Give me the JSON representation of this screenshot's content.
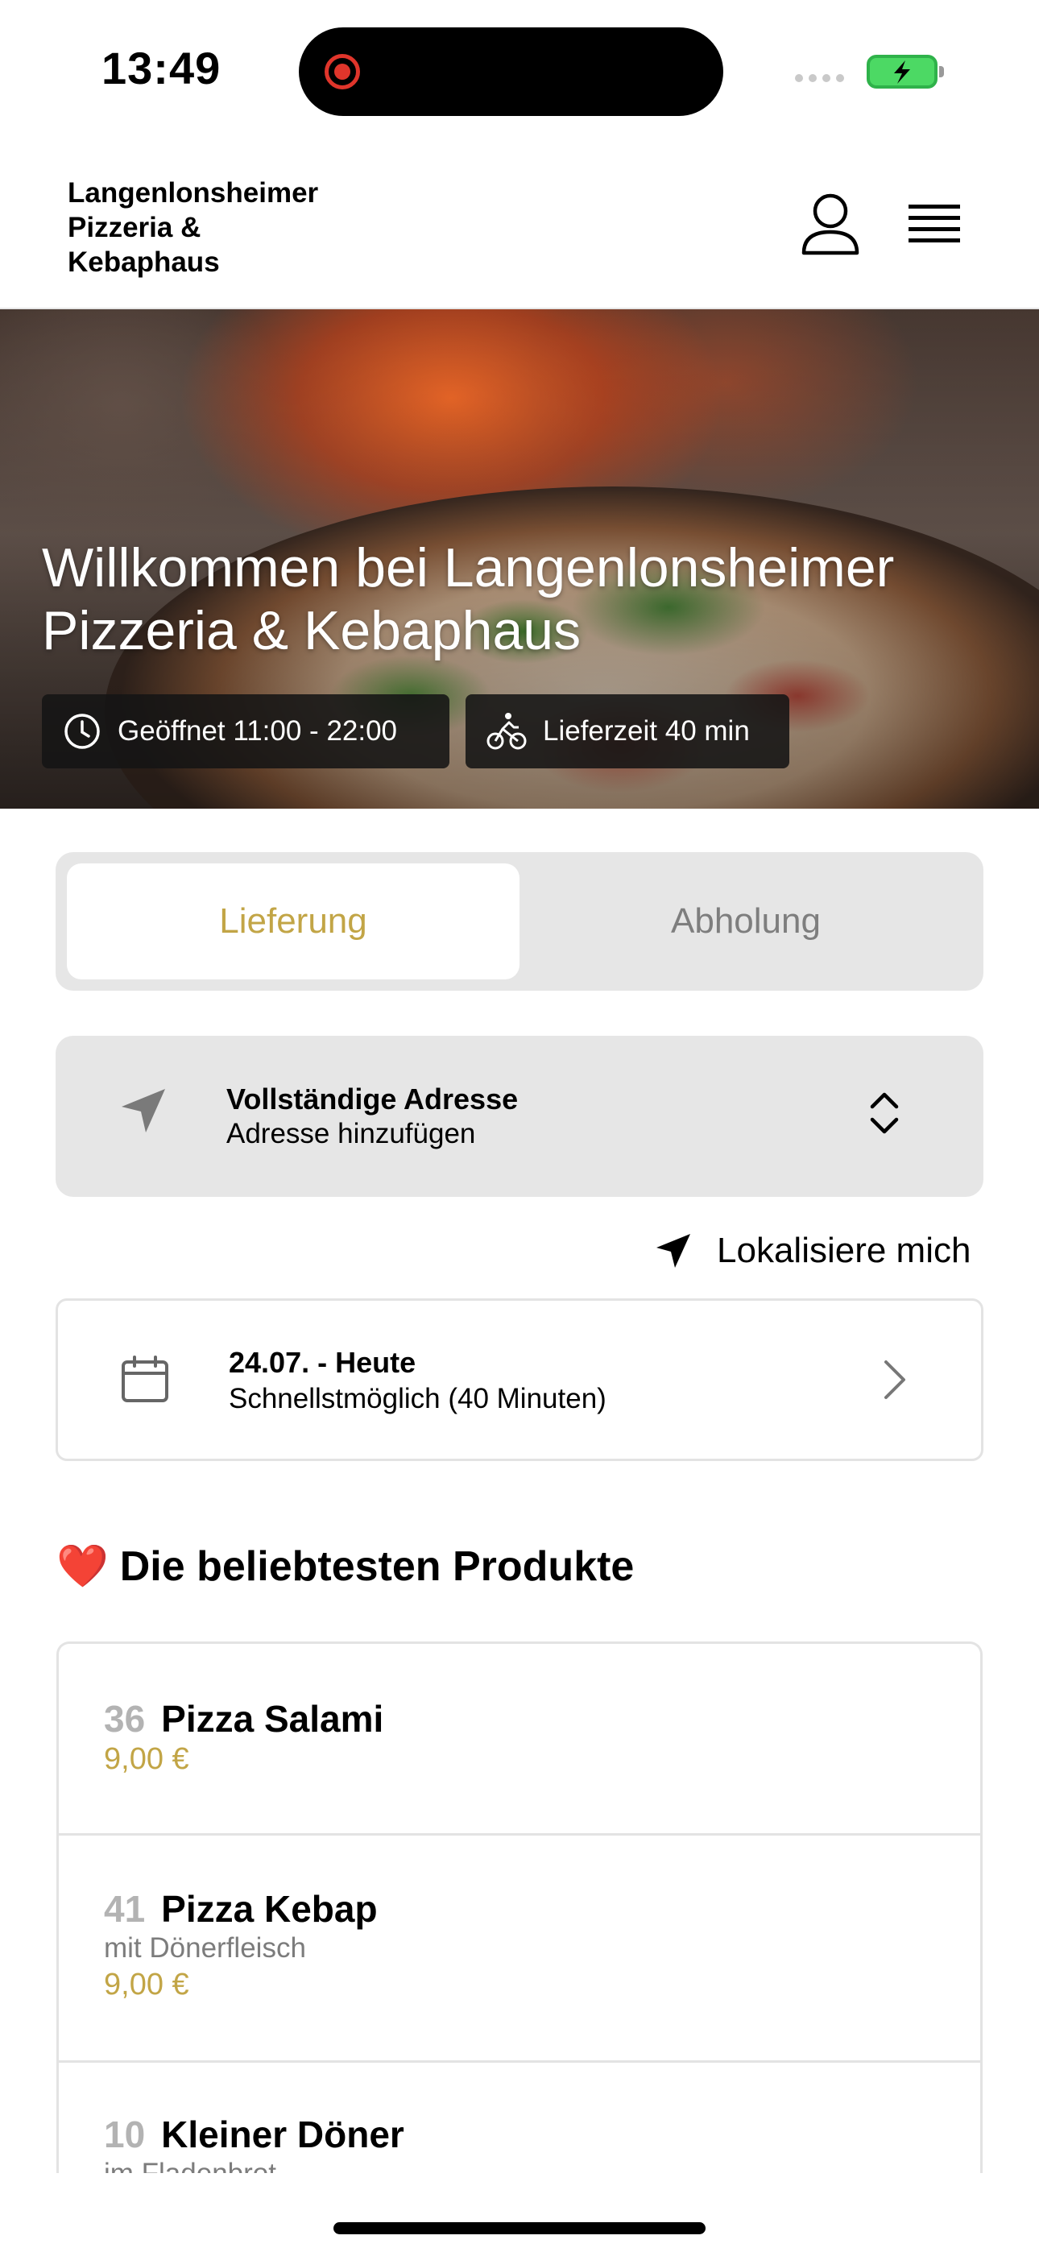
{
  "status_bar": {
    "time": "13:49"
  },
  "header": {
    "brand_name": "Langenlonsheimer\nPizzeria &\nKebaphaus",
    "user_icon": "user-icon",
    "menu_icon": "hamburger-menu-icon"
  },
  "hero": {
    "title": "Willkommen bei Langenlonsheimer Pizzeria & Kebaphaus",
    "opening_hours": "Geöffnet 11:00 - 22:00",
    "delivery_time": "Lieferzeit 40 min"
  },
  "order_mode": {
    "options": [
      "Lieferung",
      "Abholung"
    ],
    "selected": "Lieferung"
  },
  "address": {
    "title": "Vollständige Adresse",
    "subtitle": "Adresse hinzufügen"
  },
  "locate_me": "Lokalisiere mich",
  "schedule": {
    "date": "24.07. - Heute",
    "time": "Schnellstmöglich (40 Minuten)"
  },
  "popular": {
    "emoji": "❤️",
    "title": "Die beliebtesten Produkte",
    "items": [
      {
        "number": "36",
        "name": "Pizza Salami",
        "description": "",
        "price": "9,00 €"
      },
      {
        "number": "41",
        "name": "Pizza Kebap",
        "description": "mit Dönerfleisch",
        "price": "9,00 €"
      },
      {
        "number": "10",
        "name": "Kleiner Döner",
        "description": "im Fladenbrot",
        "price": ""
      }
    ]
  },
  "colors": {
    "accent": "#c2a546",
    "segment_bg": "#e6e6e6",
    "pill_bg": "#141414"
  }
}
